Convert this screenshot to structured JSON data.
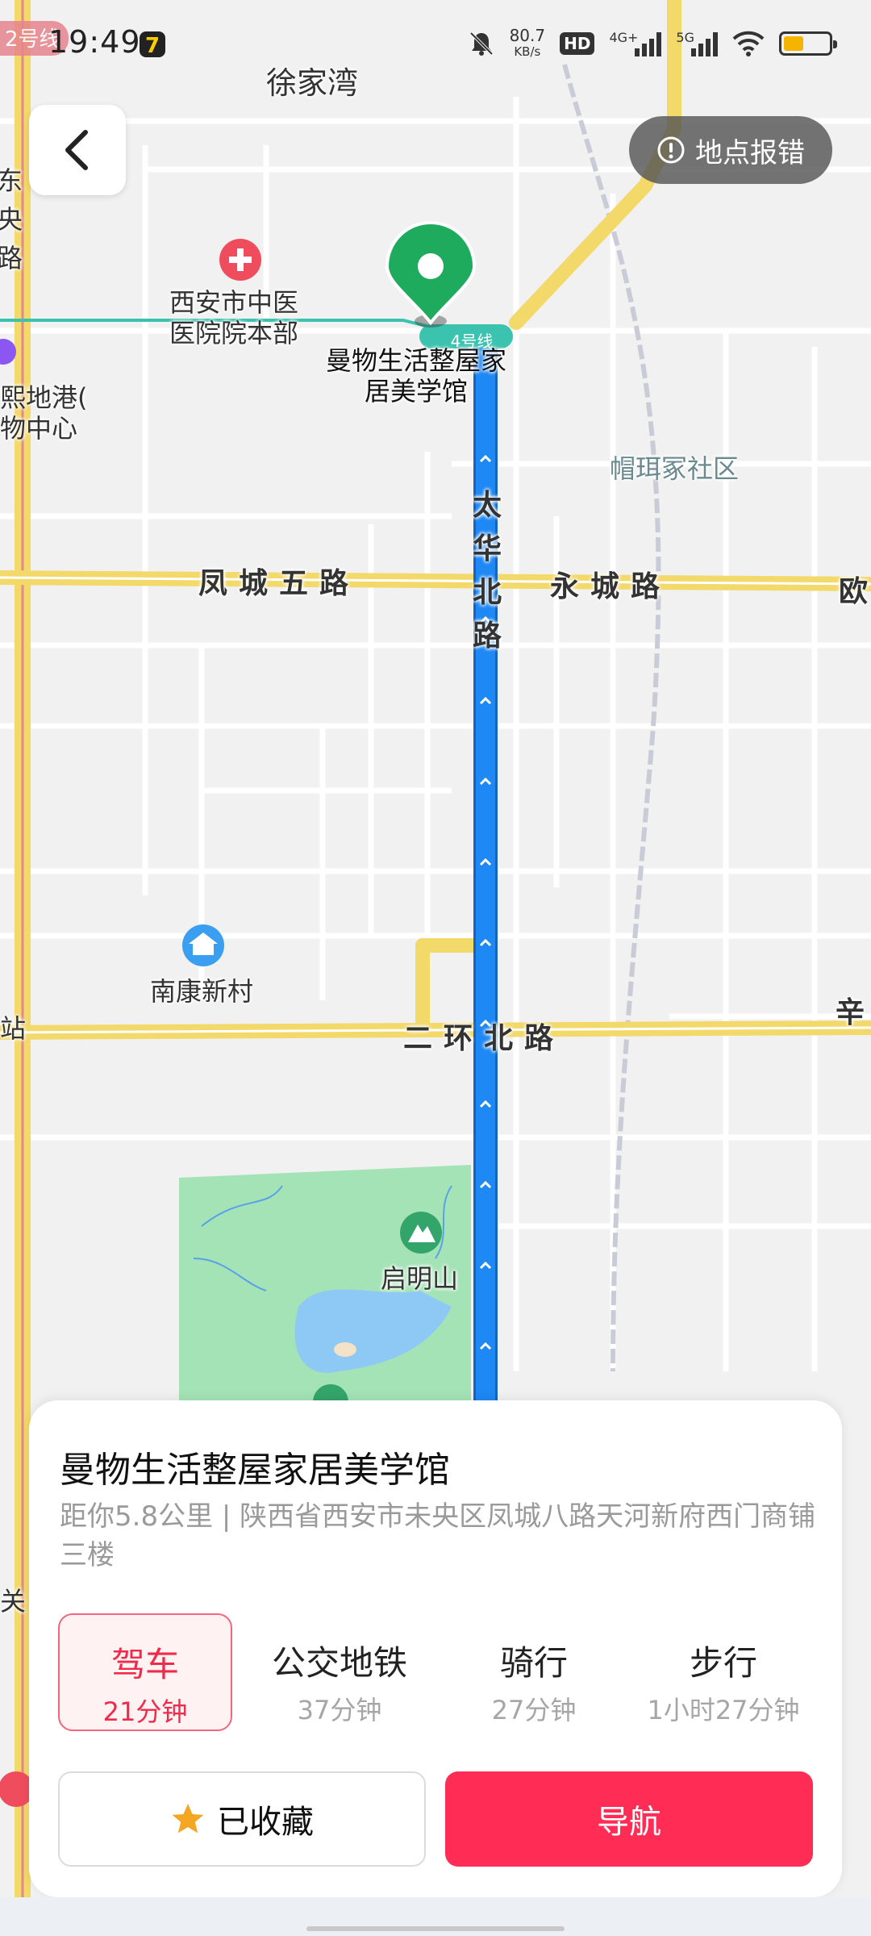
{
  "status_bar": {
    "metro_tag": "2号线",
    "time": "19:49",
    "net_speed_value": "80.7",
    "net_speed_unit": "KB/s",
    "hd_label": "HD",
    "signal1_label": "4G+",
    "signal2_label": "5G",
    "battery_level": 0.45,
    "icons": [
      "mute-bell-icon",
      "hd-icon",
      "signal-icon",
      "wifi-icon",
      "battery-icon"
    ]
  },
  "top_bar": {
    "back_icon": "chevron-left-icon",
    "report_label": "地点报错",
    "report_icon": "exclamation-circle-icon"
  },
  "map": {
    "labels": {
      "xujiawan": "徐家湾",
      "hospital": "西安市中医\n医院院本部",
      "destination": "曼物生活整屋家\n居美学馆",
      "maoer": "帽珥冢社区",
      "fengcheng5": "凤城五路",
      "yongcheng": "永城路",
      "taihua": "太华北路",
      "ou": "欧",
      "nankang": "南康新村",
      "erhuan": "二环北路",
      "xin": "辛",
      "qiming": "启明山",
      "metro4": "4号线",
      "left_vertical": "东央路",
      "left_mall": "熙地港(\n物中心",
      "zhan": "站",
      "guan": "关"
    },
    "colors": {
      "route": "#1e88f5",
      "main_road": "#f3d86a",
      "park": "#a4e3b6",
      "water": "#8ec8f5",
      "metro_line": "#3cc3b0",
      "destination_pin": "#1fab5e"
    }
  },
  "place_card": {
    "name": "曼物生活整屋家居美学馆",
    "address": "距你5.8公里 | 陕西省西安市未央区凤城八路天河新府西门商铺三楼",
    "modes": [
      {
        "label": "驾车",
        "time": "21分钟",
        "active": true
      },
      {
        "label": "公交地铁",
        "time": "37分钟",
        "active": false
      },
      {
        "label": "骑行",
        "time": "27分钟",
        "active": false
      },
      {
        "label": "步行",
        "time": "1小时27分钟",
        "active": false
      }
    ],
    "favorite_label": "已收藏",
    "favorite_icon": "star-icon",
    "navigate_label": "导航",
    "accent_color": "#ff2d55"
  }
}
